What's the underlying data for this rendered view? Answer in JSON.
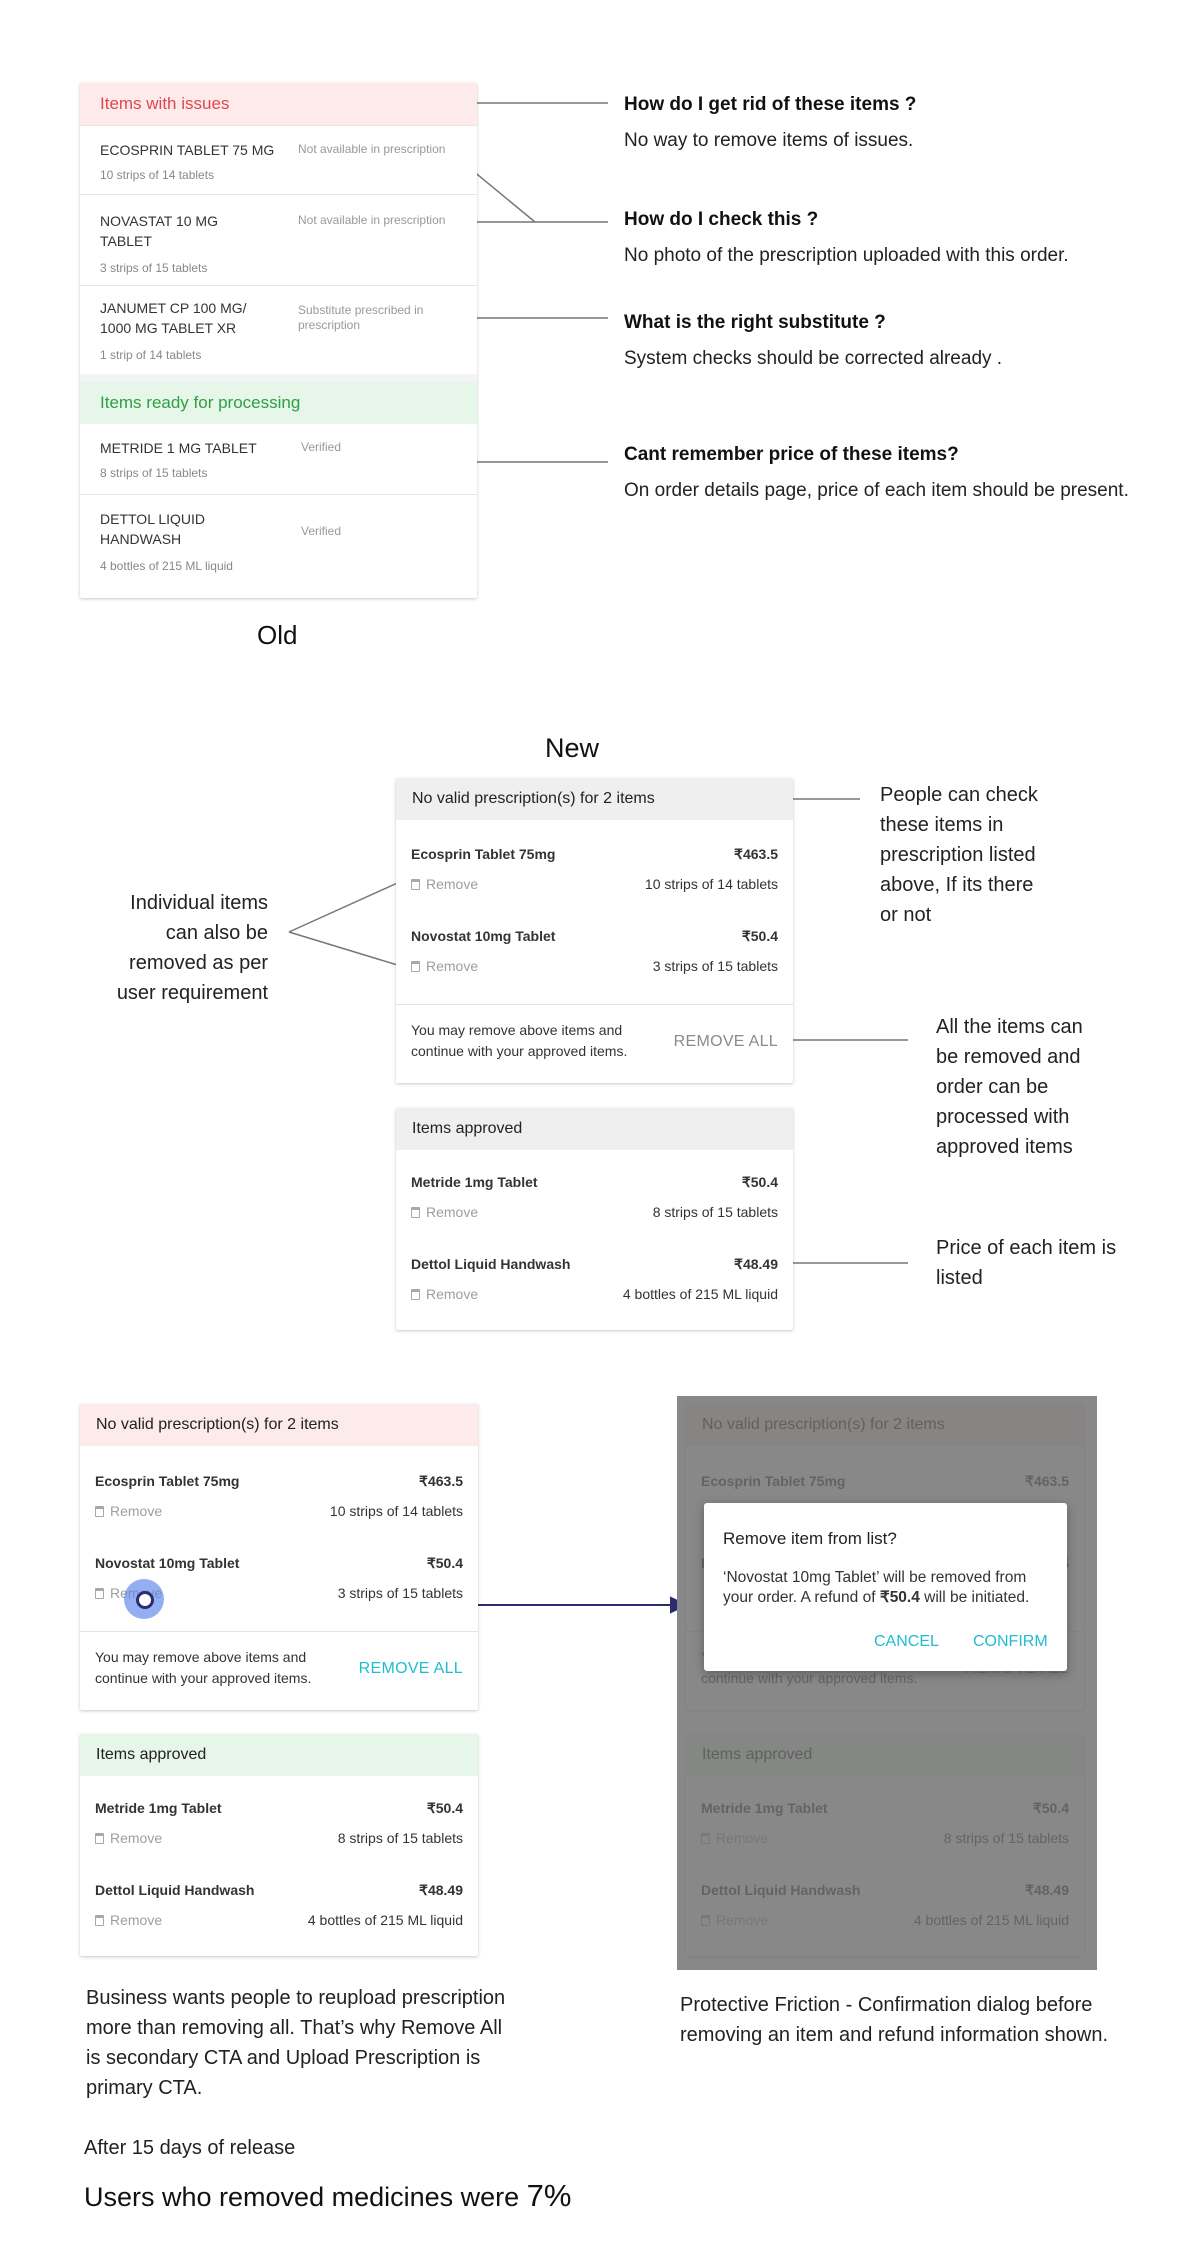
{
  "old": {
    "issues_header": "Items with issues",
    "issue_items": [
      {
        "name": "ECOSPRIN TABLET 75 MG",
        "qty": "10 strips of 14 tablets",
        "status": "Not available in prescription"
      },
      {
        "name": "NOVASTAT 10 MG TABLET",
        "qty": "3 strips of 15 tablets",
        "status": "Not available in prescription"
      },
      {
        "name": "JANUMET CP 100 MG/ 1000 MG TABLET XR",
        "qty": "1 strip of 14 tablets",
        "status": "Substitute prescribed in prescription"
      }
    ],
    "ready_header": "Items ready for processing",
    "ready_items": [
      {
        "name": "METRIDE 1 MG TABLET",
        "qty": "8 strips of 15 tablets",
        "status": "Verified"
      },
      {
        "name": "DETTOL LIQUID HANDWASH",
        "qty": "4 bottles of 215 ML liquid",
        "status": "Verified"
      }
    ],
    "caption": "Old"
  },
  "questions": [
    {
      "q": "How do I get rid of these items ?",
      "a": "No way to remove items of issues."
    },
    {
      "q": "How do I check this ?",
      "a": "No photo of the prescription uploaded with this order."
    },
    {
      "q": "What is the right substitute ?",
      "a": "System checks should be corrected already ."
    },
    {
      "q": "Cant remember price of these items?",
      "a": "On order details page, price of each item should be present."
    }
  ],
  "new": {
    "caption": "New",
    "issue_header": "No valid prescription(s) for 2 items",
    "issue_items": [
      {
        "name": "Ecosprin Tablet 75mg",
        "price": "₹463.5",
        "qty": "10 strips of 14 tablets",
        "remove": "Remove"
      },
      {
        "name": "Novostat 10mg Tablet",
        "price": "₹50.4",
        "qty": "3 strips of 15 tablets",
        "remove": "Remove"
      }
    ],
    "footer_text": "You may remove above items and continue with your approved items.",
    "remove_all": "REMOVE ALL",
    "approved_header": "Items approved",
    "approved_items": [
      {
        "name": "Metride 1mg Tablet",
        "price": "₹50.4",
        "qty": "8 strips of 15 tablets",
        "remove": "Remove"
      },
      {
        "name": "Dettol Liquid Handwash",
        "price": "₹48.49",
        "qty": "4 bottles of 215 ML liquid",
        "remove": "Remove"
      }
    ]
  },
  "notes": {
    "check_items": "People can check these items in prescription listed above, If its there or not",
    "individual": "Individual items can also be removed as per user requirement",
    "remove_all": "All the items can be removed and order can be processed with approved items",
    "price": "Price of each item is listed",
    "business": "Business wants people to reupload prescription more than removing all. That’s why Remove All is secondary CTA and Upload Prescription is primary CTA.",
    "friction": "Protective Friction - Confirmation dialog before removing an item and refund information shown."
  },
  "dialog": {
    "title": "Remove item from list?",
    "body_pre": "‘Novostat 10mg Tablet’ will be removed from your order. A refund of ",
    "body_amount": "₹50.4",
    "body_post": " will be initiated.",
    "cancel": "CANCEL",
    "confirm": "CONFIRM"
  },
  "result": {
    "label": "After 15 days of release",
    "headline": "Users who removed medicines were ",
    "value": "7%"
  },
  "colors": {
    "issue_bg": "#fdeaea",
    "issue_text": "#e0474c",
    "ready_bg": "#e6f6e8",
    "ready_text": "#2ea043",
    "accent": "#1fbcd2",
    "overlay": "#8a8a8a",
    "arrow": "#2b2d6e"
  }
}
